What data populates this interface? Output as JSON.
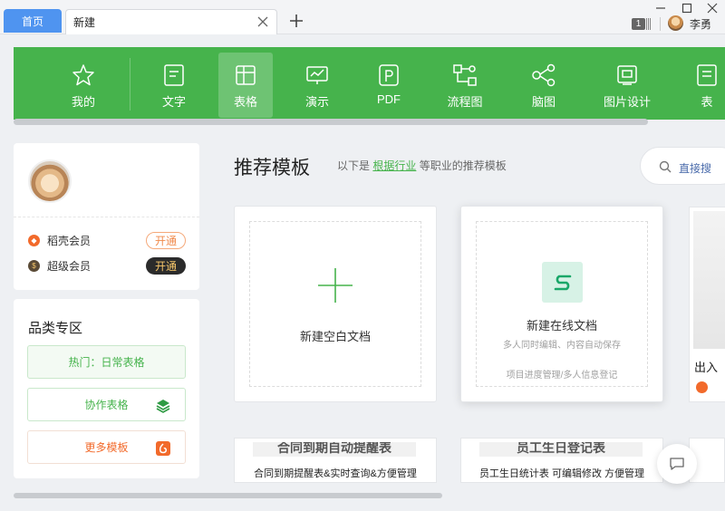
{
  "tabs": {
    "home": "首页",
    "new": "新建"
  },
  "header": {
    "badge": "1",
    "username": "李勇"
  },
  "toolbar": {
    "items": [
      {
        "label": "我的",
        "icon": "star-icon"
      },
      {
        "label": "文字",
        "icon": "doc-icon"
      },
      {
        "label": "表格",
        "icon": "table-icon"
      },
      {
        "label": "演示",
        "icon": "presentation-icon"
      },
      {
        "label": "PDF",
        "icon": "pdf-icon"
      },
      {
        "label": "流程图",
        "icon": "flowchart-icon"
      },
      {
        "label": "脑图",
        "icon": "mindmap-icon"
      },
      {
        "label": "图片设计",
        "icon": "image-design-icon"
      },
      {
        "label": "表",
        "icon": "form-icon"
      }
    ],
    "active": "表格"
  },
  "profile": {
    "members": [
      {
        "label": "稻壳会员",
        "action": "开通"
      },
      {
        "label": "超级会员",
        "action": "开通"
      }
    ]
  },
  "category": {
    "title": "品类专区",
    "hot": "热门：日常表格",
    "collab": "协作表格",
    "more": "更多模板"
  },
  "main": {
    "title": "推荐模板",
    "subtitle_prefix": "以下是",
    "subtitle_link": "根据行业",
    "subtitle_suffix": "等职业的推荐模板",
    "search_placeholder": "直接搜"
  },
  "cards": {
    "blank": "新建空白文档",
    "online": "新建在线文档",
    "online_desc": "多人同时编辑、内容自动保存",
    "online_tags": "项目进度管理/多人信息登记",
    "partial": "出入"
  },
  "templates": [
    {
      "heading": "合同到期自动提醒表",
      "desc": "合同到期提醒表&实时查询&方便管理"
    },
    {
      "heading": "员工生日登记表",
      "desc": "员工生日统计表 可编辑修改 方便管理"
    }
  ],
  "colors": {
    "brand_green": "#46b34c",
    "tab_blue": "#4f94f0",
    "orange": "#f26a2b"
  }
}
